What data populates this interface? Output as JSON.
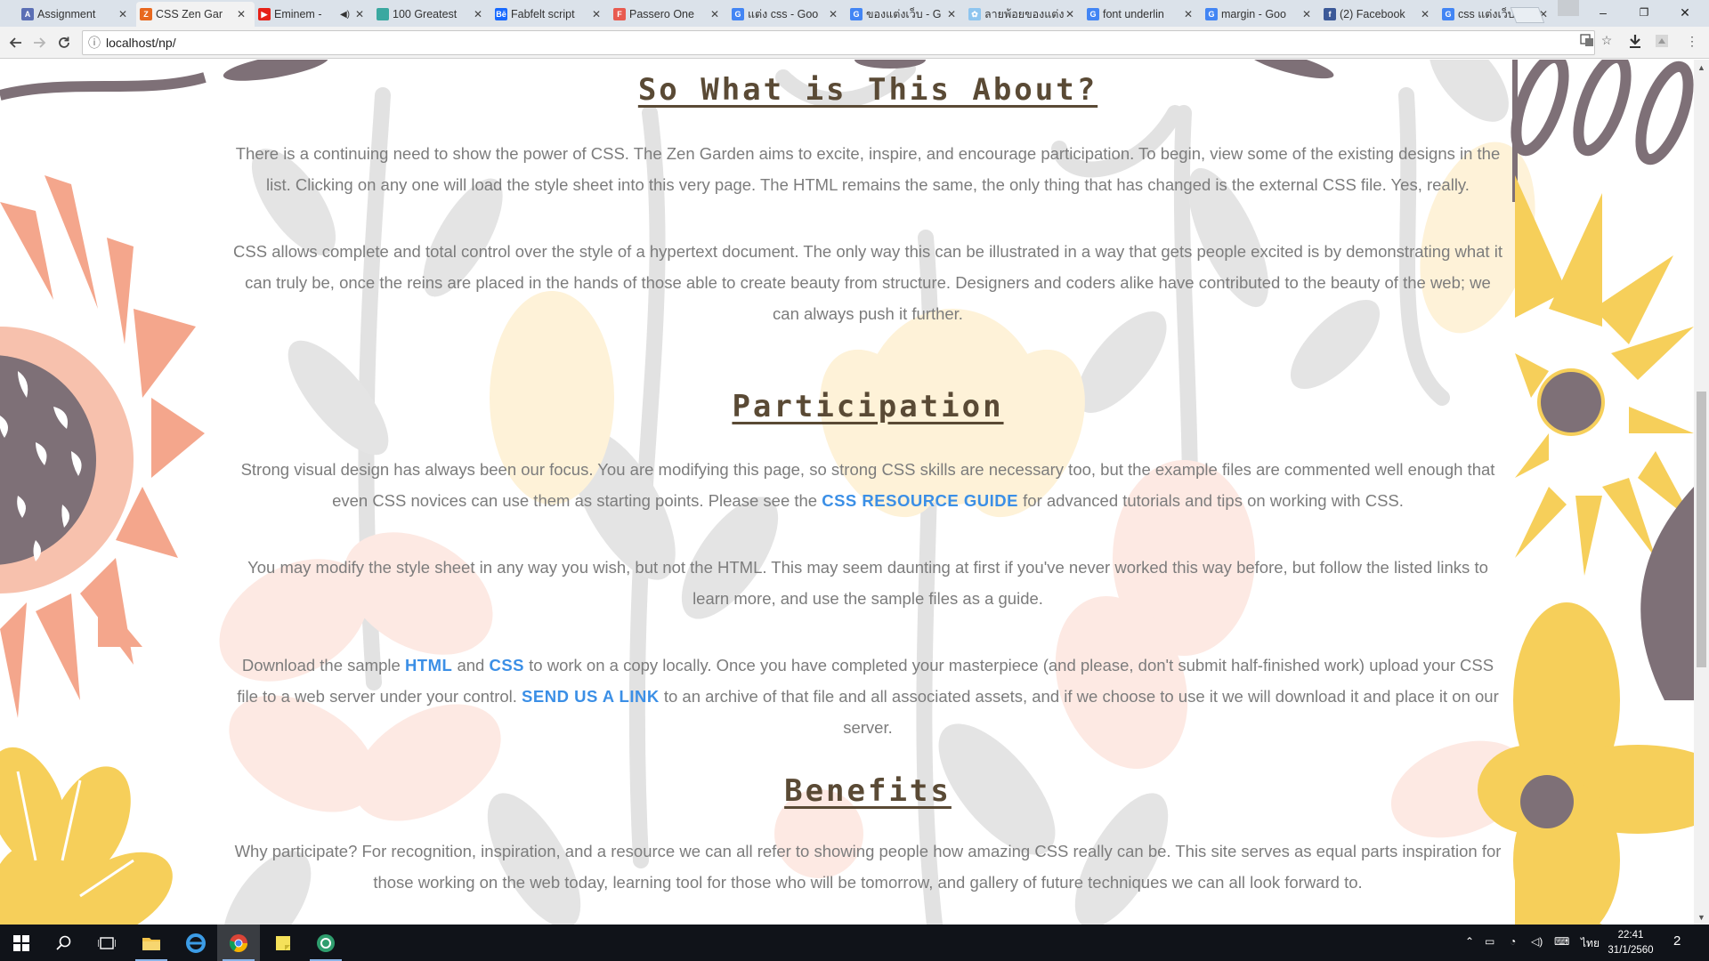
{
  "browser": {
    "tabs": [
      {
        "title": "Assignment",
        "favicon_color": "#5b6fb5",
        "favicon_char": "A",
        "active": false
      },
      {
        "title": "CSS Zen Gar",
        "favicon_color": "#e8681e",
        "favicon_char": "Z",
        "active": true
      },
      {
        "title": "Eminem -",
        "favicon_color": "#e62117",
        "favicon_char": "▶",
        "active": false,
        "audio": true
      },
      {
        "title": "100 Greatest",
        "favicon_color": "#3aa8a0",
        "favicon_char": "",
        "active": false
      },
      {
        "title": "Fabfelt script",
        "favicon_color": "#1769ff",
        "favicon_char": "Bē",
        "active": false
      },
      {
        "title": "Passero One",
        "favicon_color": "#e85a4f",
        "favicon_char": "F",
        "active": false
      },
      {
        "title": "แต่ง css - Goo",
        "favicon_color": "#4285f4",
        "favicon_char": "G",
        "active": false
      },
      {
        "title": "ของแต่งเว็บ - G",
        "favicon_color": "#4285f4",
        "favicon_char": "G",
        "active": false
      },
      {
        "title": "ลายพ้อยของแต่ง",
        "favicon_color": "#8ec5ef",
        "favicon_char": "✿",
        "active": false
      },
      {
        "title": "font underlin",
        "favicon_color": "#4285f4",
        "favicon_char": "G",
        "active": false
      },
      {
        "title": "margin - Goo",
        "favicon_color": "#4285f4",
        "favicon_char": "G",
        "active": false
      },
      {
        "title": "(2) Facebook",
        "favicon_color": "#3b5998",
        "favicon_char": "f",
        "active": false
      },
      {
        "title": "css แต่งเว็บ - G",
        "favicon_color": "#4285f4",
        "favicon_char": "G",
        "active": false
      }
    ],
    "window_controls": {
      "minimize": "–",
      "maximize": "❐",
      "close": "✕"
    },
    "url": "localhost/np/",
    "icons": {
      "back": "back-arrow-icon",
      "forward": "forward-arrow-icon",
      "reload": "reload-icon",
      "info": "info-icon",
      "translate": "translate-icon",
      "bookmark": "star-icon",
      "download": "download-icon",
      "extension": "extension-icon",
      "menu": "kebab-menu-icon"
    }
  },
  "page": {
    "sections": [
      {
        "heading": "So What is This About?",
        "paragraphs": [
          {
            "text": "There is a continuing need to show the power of CSS. The Zen Garden aims to excite, inspire, and encourage participation. To begin, view some of the existing designs in the list. Clicking on any one will load the style sheet into this very page. The HTML remains the same, the only thing that has changed is the external CSS file. Yes, really."
          },
          {
            "text": "CSS allows complete and total control over the style of a hypertext document. The only way this can be illustrated in a way that gets people excited is by demonstrating what it can truly be, once the reins are placed in the hands of those able to create beauty from structure. Designers and coders alike have contributed to the beauty of the web; we can always push it further."
          }
        ]
      },
      {
        "heading": "Participation",
        "paragraphs": [
          {
            "before": "Strong visual design has always been our focus. You are modifying this page, so strong CSS skills are necessary too, but the example files are commented well enough that even CSS novices can use them as starting points. Please see the ",
            "link": "CSS RESOURCE GUIDE",
            "after": " for advanced tutorials and tips on working with CSS."
          },
          {
            "text": "You may modify the style sheet in any way you wish, but not the HTML. This may seem daunting at first if you've never worked this way before, but follow the listed links to learn more, and use the sample files as a guide."
          },
          {
            "part1": "Download the sample ",
            "link1": "HTML",
            "part2": " and ",
            "link2": "CSS",
            "part3": " to work on a copy locally. Once you have completed your masterpiece (and please, don't submit half-finished work) upload your CSS file to a web server under your control. ",
            "link3": "SEND US A LINK",
            "part4": " to an archive of that file and all associated assets, and if we choose to use it we will download it and place it on our server."
          }
        ]
      },
      {
        "heading": "Benefits",
        "paragraphs": [
          {
            "text": "Why participate? For recognition, inspiration, and a resource we can all refer to showing people how amazing CSS really can be. This site serves as equal parts inspiration for those working on the web today, learning tool for those who will be tomorrow, and gallery of future techniques we can all look forward to."
          }
        ]
      }
    ],
    "colors": {
      "heading": "#5a4a35",
      "body_text": "#7c7c7c",
      "link": "#3b8fe6",
      "salmon": "#f4a68c",
      "yellow": "#f6cf5a",
      "taupe": "#7e7077",
      "grey_leaf": "#dcdcdc"
    }
  },
  "taskbar": {
    "items": [
      "windows-start-icon",
      "search-icon",
      "task-view-icon",
      "file-explorer-icon",
      "edge-icon",
      "chrome-icon",
      "sticky-notes-icon",
      "app-icon"
    ],
    "tray": {
      "language": "ไทย",
      "time": "22:41",
      "date": "31/1/2560",
      "notification_count": "2"
    }
  }
}
